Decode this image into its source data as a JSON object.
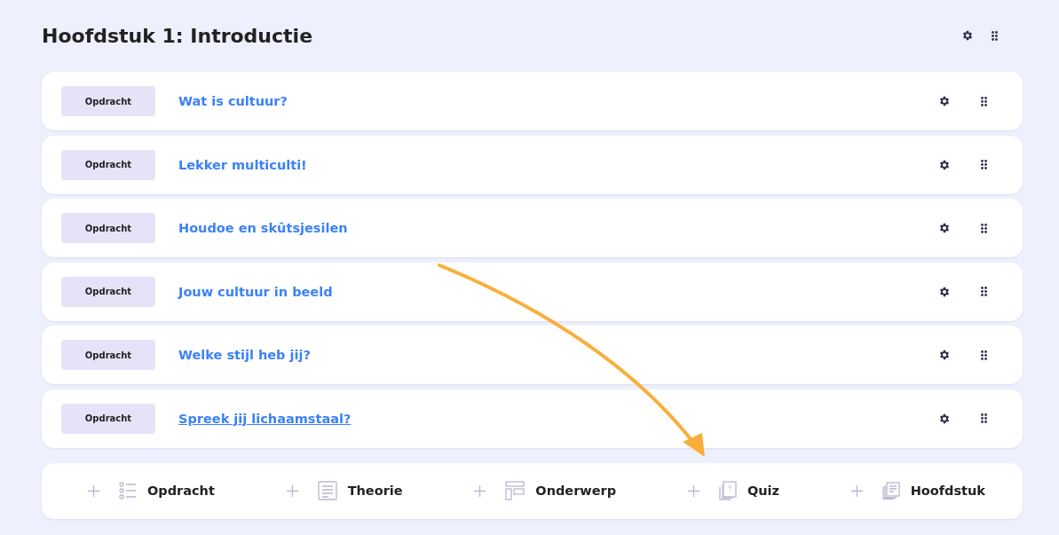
{
  "chapter": {
    "title": "Hoofdstuk 1: Introductie"
  },
  "items": [
    {
      "tag": "Opdracht",
      "title": "Wat is cultuur?",
      "hovered": false
    },
    {
      "tag": "Opdracht",
      "title": "Lekker multiculti!",
      "hovered": false
    },
    {
      "tag": "Opdracht",
      "title": "Houdoe en skûtsjesilen",
      "hovered": false
    },
    {
      "tag": "Opdracht",
      "title": "Jouw cultuur in beeld",
      "hovered": false
    },
    {
      "tag": "Opdracht",
      "title": "Welke stijl heb jij?",
      "hovered": false
    },
    {
      "tag": "Opdracht",
      "title": "Spreek jij lichaamstaal?",
      "hovered": true
    }
  ],
  "add_bar": [
    {
      "kind": "list",
      "label": "Opdracht"
    },
    {
      "kind": "text",
      "label": "Theorie"
    },
    {
      "kind": "layout",
      "label": "Onderwerp"
    },
    {
      "kind": "quiz",
      "label": "Quiz"
    },
    {
      "kind": "chapter",
      "label": "Hoofdstuk"
    }
  ]
}
